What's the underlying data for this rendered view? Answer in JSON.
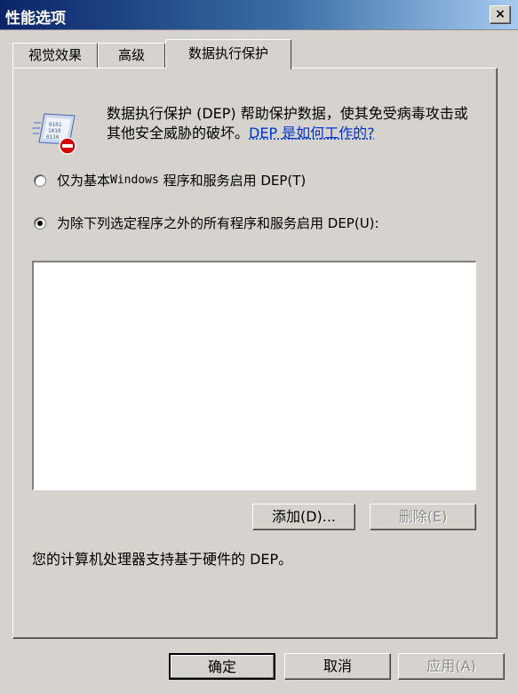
{
  "window": {
    "title": "性能选项",
    "close_glyph": "×"
  },
  "tabs": [
    {
      "label": "视觉效果"
    },
    {
      "label": "高级"
    },
    {
      "label": "数据执行保护"
    }
  ],
  "dep": {
    "description": "数据执行保护 (DEP) 帮助保护数据，使其免受病毒攻击或其他安全威胁的破坏。",
    "help_link": "DEP 是如何工作的?",
    "option_basic": {
      "text_a": "仅为基本 ",
      "text_mono": "Windows",
      "text_b": " 程序和服务启用 DEP(T)",
      "checked": false
    },
    "option_all": {
      "text": "为除下列选定程序之外的所有程序和服务启用 DEP(U):",
      "checked": true
    },
    "add_button": "添加(D)...",
    "remove_button": "删除(E)",
    "status": "您的计算机处理器支持基于硬件的 DEP。"
  },
  "footer": {
    "ok": "确定",
    "cancel": "取消",
    "apply": "应用(A)"
  },
  "icon": {
    "name": "dep-shield-binary-icon"
  }
}
